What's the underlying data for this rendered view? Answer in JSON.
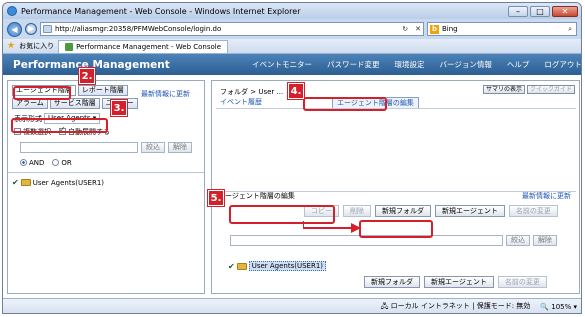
{
  "window": {
    "title": "Performance Management - Web Console - Windows Internet Explorer"
  },
  "browser": {
    "url": "http://aliasmgr:20358/PFMWebConsole/login.do",
    "search_engine": "Bing",
    "favorites_label": "お気に入り",
    "tab_label": "Performance Management - Web Console"
  },
  "app": {
    "title": "Performance Management",
    "nav": [
      "イベントモニター",
      "パスワード変更",
      "環境設定",
      "バージョン情報",
      "ヘルプ",
      "ログアウト"
    ]
  },
  "left": {
    "tabs": [
      "エージェント階層",
      "レポート階層",
      "アラーム",
      "サービス階層",
      "ユーザー"
    ],
    "refresh": "最新情報に更新",
    "display_format_label": "表示形式",
    "display_format_value": "User Agents",
    "multi_select": "複数選択",
    "auto_expand": "自動展開する",
    "narrow_btn": "絞込",
    "clear_btn": "解除",
    "and_label": "AND",
    "or_label": "OR",
    "tree_item": "User Agents(USER1)"
  },
  "right": {
    "breadcrumb": "フォルダ > User ...",
    "summary_btn": "サマリの表示",
    "quick_guide_btn": "クイックガイド",
    "tab_event_history": "イベント履歴",
    "tab_edit_hierarchy": "エージェント階層の編集",
    "section_title": "エージェント階層の編集",
    "section_refresh": "最新情報に更新",
    "btn_copy": "コピー",
    "btn_delete": "削除",
    "btn_new_folder": "新規フォルダ",
    "btn_new_agent": "新規エージェント",
    "btn_rename": "名前の変更",
    "narrow_btn": "絞込",
    "clear_btn": "解除",
    "tree_item": "User Agents(USER1)"
  },
  "callouts": [
    "2.",
    "3.",
    "4.",
    "5."
  ],
  "statusbar": {
    "zone": "ローカル イントラネット | 保護モード: 無効",
    "zoom": "105%"
  },
  "colors": {
    "accent": "#d4202a",
    "nav_bg": "#2c5e92",
    "link": "#1f56b3"
  }
}
